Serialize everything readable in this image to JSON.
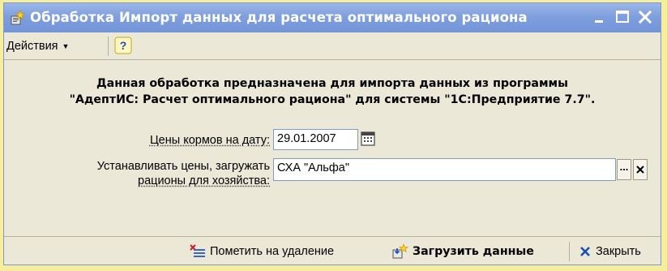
{
  "window": {
    "title": "Обработка  Импорт данных для расчета оптимального рациона",
    "minimize_label": "minimize",
    "maximize_label": "maximize",
    "close_label": "close"
  },
  "toolbar": {
    "actions_label": "Действия",
    "help_label": "?"
  },
  "description": {
    "line1": "Данная обработка предназначена для импорта данных из программы",
    "line2": "\"АдептИС: Расчет оптимального рациона\" для системы \"1С:Предприятие 7.7\"."
  },
  "form": {
    "date_label": "Цены кормов на дату:",
    "date_value": "29.01.2007",
    "farm_label_line1": "Устанавливать цены, загружать",
    "farm_label_line2": "рационы для хозяйства:",
    "farm_value": "СХА \"Альфа\"",
    "select_button_label": "...",
    "clear_button_label": "×"
  },
  "bottom": {
    "mark_delete_label": "Пометить на удаление",
    "load_label": "Загрузить данные",
    "close_label": "Закрыть"
  },
  "colors": {
    "titlebar": "#7f9fdd",
    "window_bg": "#ece8d8",
    "outer_bg": "#f7ee9c"
  }
}
